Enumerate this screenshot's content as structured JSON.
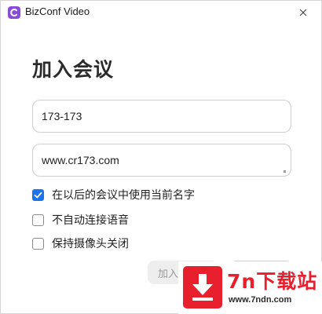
{
  "window": {
    "title": "BizConf Video"
  },
  "page": {
    "heading": "加入会议"
  },
  "form": {
    "meeting_id_value": "173-173",
    "name_value": "www.cr173.com"
  },
  "options": [
    {
      "label": "在以后的会议中使用当前名字",
      "checked": true
    },
    {
      "label": "不自动连接语音",
      "checked": false
    },
    {
      "label": "保持摄像头关闭",
      "checked": false
    }
  ],
  "buttons": {
    "join_label": "加入"
  },
  "watermark": {
    "title": "7n下载站",
    "url": "www.7ndn.com"
  },
  "colors": {
    "accent": "#1a73e8",
    "app_icon": "#8a4bd6",
    "watermark_red": "#e8202e"
  },
  "icons": {
    "app": "app-logo-icon",
    "close": "close-icon",
    "check": "checkmark-icon",
    "watermark": "download-arrow-icon"
  }
}
